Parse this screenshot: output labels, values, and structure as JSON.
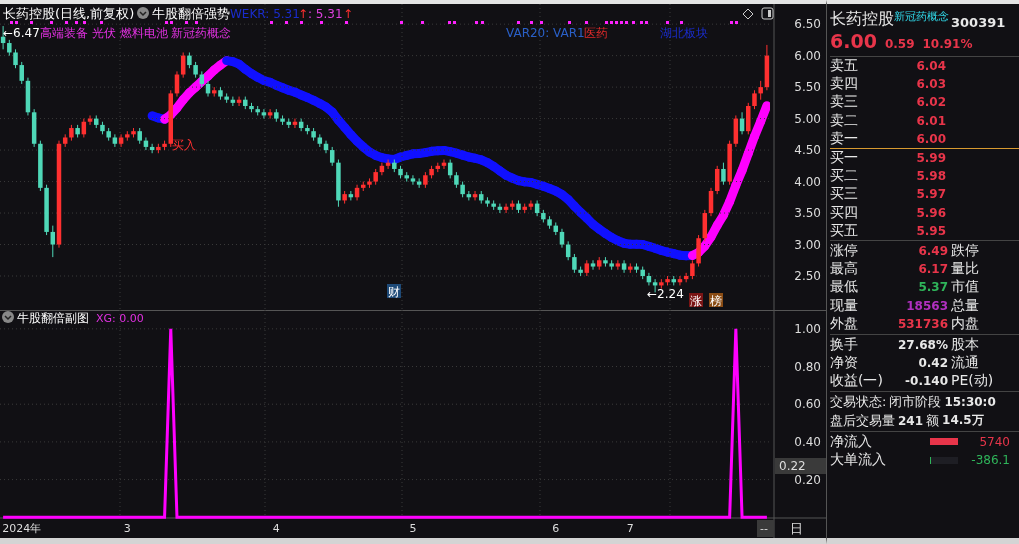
{
  "header": {
    "title": "长药控股(日线,前复权)",
    "indicator": "牛股翻倍强势",
    "wekr": "WEKR: 5.31",
    "arrow": "↑",
    "value2": ": 5.31",
    "arrow2": "↑"
  },
  "main_chart": {
    "high_marker": "←6.47",
    "concepts": "高端装备 光伏 燃料电池 新冠药概念",
    "var_label": "VAR20: VAR1",
    "sector": "医药",
    "region": "湖北板块",
    "buy_label": "买入",
    "low_marker": "←2.24",
    "badges": [
      {
        "text": "财",
        "color": "#1e4a78"
      },
      {
        "text": "涨",
        "color": "#7a1414"
      },
      {
        "text": "榜",
        "color": "#8a4c14"
      }
    ],
    "chart_data": {
      "type": "candlestick",
      "ylim": [
        1.96,
        6.82
      ],
      "grid": true,
      "yticks": [
        {
          "value": 6.5,
          "label": "6.50"
        },
        {
          "value": 6,
          "label": "6.00"
        },
        {
          "value": 5.5,
          "label": "5.50"
        },
        {
          "value": 5,
          "label": "5.00"
        },
        {
          "value": 4.5,
          "label": "4.50"
        },
        {
          "value": 4,
          "label": "4.00"
        },
        {
          "value": 3.5,
          "label": "3.50"
        },
        {
          "value": 3,
          "label": "3.00"
        },
        {
          "value": 2.5,
          "label": "2.50"
        }
      ],
      "categories": [
        null,
        null,
        null,
        null,
        null,
        null,
        null,
        null,
        null,
        null,
        null,
        null,
        null,
        null,
        null,
        null,
        null,
        null,
        null,
        null,
        null,
        null,
        null,
        null,
        null,
        null,
        null,
        null,
        null,
        null,
        null,
        null,
        null,
        null,
        null,
        null,
        null,
        null,
        null,
        null,
        null,
        null,
        null,
        null,
        null,
        null,
        null,
        null,
        null,
        null,
        null,
        null,
        null,
        null,
        null,
        null,
        null,
        null,
        null,
        null,
        null,
        null,
        null,
        null,
        null,
        null,
        null,
        null,
        null,
        null,
        null,
        null,
        null,
        null,
        null,
        null,
        null,
        null,
        null,
        null,
        null,
        null,
        null,
        null,
        null,
        null,
        null,
        null,
        null,
        null,
        null,
        null,
        null,
        null,
        null,
        null,
        null,
        null,
        null,
        null,
        null,
        null,
        null,
        null,
        null,
        null,
        null,
        null,
        null,
        null,
        null,
        null,
        null,
        null,
        null,
        null,
        null,
        null,
        null,
        null,
        null,
        null,
        null,
        null
      ],
      "ohlc": [
        [
          6.3,
          6.47,
          6.1,
          6.2
        ],
        [
          6.2,
          6.25,
          6.0,
          6.05
        ],
        [
          6.05,
          6.1,
          5.8,
          5.85
        ],
        [
          5.85,
          5.9,
          5.55,
          5.6
        ],
        [
          5.6,
          5.65,
          5.05,
          5.1
        ],
        [
          5.1,
          5.15,
          4.55,
          4.6
        ],
        [
          4.6,
          4.65,
          3.85,
          3.9
        ],
        [
          3.9,
          3.95,
          3.15,
          3.2
        ],
        [
          3.2,
          3.3,
          2.8,
          3.0
        ],
        [
          3.0,
          4.65,
          2.95,
          4.6
        ],
        [
          4.6,
          4.75,
          4.55,
          4.7
        ],
        [
          4.7,
          4.9,
          4.65,
          4.85
        ],
        [
          4.85,
          4.9,
          4.7,
          4.75
        ],
        [
          4.75,
          5.0,
          4.7,
          4.95
        ],
        [
          4.95,
          5.05,
          4.9,
          5.0
        ],
        [
          5.0,
          5.05,
          4.85,
          4.9
        ],
        [
          4.9,
          4.95,
          4.75,
          4.8
        ],
        [
          4.8,
          4.85,
          4.65,
          4.7
        ],
        [
          4.7,
          4.75,
          4.55,
          4.6
        ],
        [
          4.6,
          4.75,
          4.55,
          4.7
        ],
        [
          4.7,
          4.8,
          4.65,
          4.75
        ],
        [
          4.75,
          4.85,
          4.7,
          4.8
        ],
        [
          4.8,
          4.85,
          4.6,
          4.65
        ],
        [
          4.65,
          4.7,
          4.5,
          4.55
        ],
        [
          4.55,
          4.6,
          4.45,
          4.5
        ],
        [
          4.5,
          4.6,
          4.45,
          4.55
        ],
        [
          4.55,
          4.65,
          4.5,
          4.6
        ],
        [
          4.6,
          5.45,
          4.55,
          5.4
        ],
        [
          5.4,
          5.75,
          5.35,
          5.7
        ],
        [
          5.7,
          6.05,
          5.65,
          6.0
        ],
        [
          6.0,
          6.05,
          5.8,
          5.85
        ],
        [
          5.85,
          5.9,
          5.65,
          5.7
        ],
        [
          5.7,
          5.75,
          5.5,
          5.55
        ],
        [
          5.55,
          5.6,
          5.35,
          5.4
        ],
        [
          5.4,
          5.5,
          5.35,
          5.45
        ],
        [
          5.45,
          5.5,
          5.3,
          5.35
        ],
        [
          5.35,
          5.4,
          5.25,
          5.3
        ],
        [
          5.3,
          5.35,
          5.2,
          5.25
        ],
        [
          5.25,
          5.35,
          5.2,
          5.3
        ],
        [
          5.3,
          5.35,
          5.15,
          5.2
        ],
        [
          5.2,
          5.25,
          5.1,
          5.15
        ],
        [
          5.15,
          5.2,
          5.05,
          5.1
        ],
        [
          5.1,
          5.15,
          5.0,
          5.05
        ],
        [
          5.05,
          5.15,
          5.0,
          5.1
        ],
        [
          5.1,
          5.15,
          4.95,
          5.0
        ],
        [
          5.0,
          5.05,
          4.9,
          4.95
        ],
        [
          4.95,
          5.0,
          4.85,
          4.9
        ],
        [
          4.9,
          5.0,
          4.85,
          4.95
        ],
        [
          4.95,
          5.0,
          4.8,
          4.85
        ],
        [
          4.85,
          4.9,
          4.75,
          4.8
        ],
        [
          4.8,
          4.85,
          4.65,
          4.7
        ],
        [
          4.7,
          4.75,
          4.55,
          4.6
        ],
        [
          4.6,
          4.65,
          4.45,
          4.5
        ],
        [
          4.5,
          4.55,
          4.25,
          4.3
        ],
        [
          4.3,
          4.35,
          3.6,
          3.7
        ],
        [
          3.7,
          3.85,
          3.65,
          3.8
        ],
        [
          3.8,
          3.85,
          3.7,
          3.75
        ],
        [
          3.75,
          3.95,
          3.7,
          3.9
        ],
        [
          3.9,
          4.0,
          3.85,
          3.95
        ],
        [
          3.95,
          4.05,
          3.9,
          4.0
        ],
        [
          4.0,
          4.2,
          3.95,
          4.15
        ],
        [
          4.15,
          4.3,
          4.1,
          4.25
        ],
        [
          4.25,
          4.35,
          4.2,
          4.3
        ],
        [
          4.3,
          4.35,
          4.15,
          4.2
        ],
        [
          4.2,
          4.25,
          4.05,
          4.1
        ],
        [
          4.1,
          4.15,
          4.0,
          4.05
        ],
        [
          4.05,
          4.1,
          3.95,
          4.0
        ],
        [
          4.0,
          4.05,
          3.9,
          3.95
        ],
        [
          3.95,
          4.15,
          3.9,
          4.1
        ],
        [
          4.1,
          4.25,
          4.05,
          4.2
        ],
        [
          4.2,
          4.3,
          4.15,
          4.25
        ],
        [
          4.25,
          4.35,
          4.2,
          4.3
        ],
        [
          4.3,
          4.35,
          4.05,
          4.1
        ],
        [
          4.1,
          4.15,
          3.9,
          3.95
        ],
        [
          3.95,
          4.0,
          3.75,
          3.8
        ],
        [
          3.8,
          3.85,
          3.7,
          3.75
        ],
        [
          3.75,
          3.85,
          3.7,
          3.8
        ],
        [
          3.8,
          3.85,
          3.65,
          3.7
        ],
        [
          3.7,
          3.75,
          3.6,
          3.65
        ],
        [
          3.65,
          3.7,
          3.55,
          3.6
        ],
        [
          3.6,
          3.65,
          3.5,
          3.55
        ],
        [
          3.55,
          3.65,
          3.5,
          3.6
        ],
        [
          3.6,
          3.7,
          3.55,
          3.65
        ],
        [
          3.65,
          3.7,
          3.5,
          3.55
        ],
        [
          3.55,
          3.65,
          3.5,
          3.6
        ],
        [
          3.6,
          3.7,
          3.55,
          3.65
        ],
        [
          3.65,
          3.7,
          3.45,
          3.5
        ],
        [
          3.5,
          3.55,
          3.35,
          3.4
        ],
        [
          3.4,
          3.45,
          3.25,
          3.3
        ],
        [
          3.3,
          3.35,
          3.15,
          3.2
        ],
        [
          3.2,
          3.25,
          2.95,
          3.0
        ],
        [
          3.0,
          3.05,
          2.75,
          2.8
        ],
        [
          2.8,
          2.85,
          2.55,
          2.6
        ],
        [
          2.6,
          2.65,
          2.5,
          2.55
        ],
        [
          2.55,
          2.75,
          2.5,
          2.7
        ],
        [
          2.7,
          2.75,
          2.6,
          2.65
        ],
        [
          2.65,
          2.8,
          2.6,
          2.75
        ],
        [
          2.75,
          2.8,
          2.65,
          2.7
        ],
        [
          2.7,
          2.75,
          2.6,
          2.65
        ],
        [
          2.65,
          2.75,
          2.6,
          2.7
        ],
        [
          2.7,
          2.75,
          2.55,
          2.6
        ],
        [
          2.6,
          2.7,
          2.55,
          2.65
        ],
        [
          2.65,
          2.7,
          2.55,
          2.6
        ],
        [
          2.6,
          2.65,
          2.45,
          2.5
        ],
        [
          2.5,
          2.55,
          2.35,
          2.4
        ],
        [
          2.4,
          2.45,
          2.24,
          2.35
        ],
        [
          2.35,
          2.45,
          2.3,
          2.4
        ],
        [
          2.4,
          2.5,
          2.35,
          2.45
        ],
        [
          2.45,
          2.5,
          2.35,
          2.4
        ],
        [
          2.4,
          2.5,
          2.35,
          2.45
        ],
        [
          2.45,
          2.55,
          2.4,
          2.5
        ],
        [
          2.5,
          2.75,
          2.45,
          2.7
        ],
        [
          2.7,
          3.15,
          2.65,
          3.1
        ],
        [
          3.1,
          3.55,
          3.05,
          3.5
        ],
        [
          3.5,
          3.9,
          3.45,
          3.85
        ],
        [
          3.85,
          4.25,
          3.8,
          4.2
        ],
        [
          4.2,
          4.3,
          3.95,
          4.0
        ],
        [
          4.0,
          4.65,
          3.95,
          4.6
        ],
        [
          4.6,
          5.05,
          4.55,
          5.0
        ],
        [
          5.0,
          5.1,
          4.75,
          4.8
        ],
        [
          4.8,
          5.25,
          4.75,
          5.2
        ],
        [
          5.2,
          5.45,
          5.15,
          5.4
        ],
        [
          5.4,
          5.6,
          5.3,
          5.5
        ],
        [
          5.5,
          6.17,
          5.45,
          6.0
        ]
      ]
    }
  },
  "sub_chart": {
    "title": "牛股翻倍副图",
    "reading": ": 0.00",
    "current": "0.22",
    "chart_data": {
      "type": "line",
      "ylim": [
        -0.11,
        1.1
      ],
      "grid": true,
      "categories": [
        null,
        null,
        null,
        "2024年",
        null,
        null,
        null,
        null,
        null,
        null,
        null,
        null,
        null,
        null,
        null,
        null,
        null,
        null,
        null,
        null,
        "3",
        null,
        null,
        null,
        null,
        null,
        null,
        null,
        null,
        null,
        null,
        null,
        null,
        null,
        null,
        null,
        null,
        null,
        null,
        null,
        null,
        null,
        null,
        null,
        "4",
        null,
        null,
        null,
        null,
        null,
        null,
        null,
        null,
        null,
        null,
        null,
        null,
        null,
        null,
        null,
        null,
        null,
        null,
        null,
        null,
        null,
        "5",
        null,
        null,
        null,
        null,
        null,
        null,
        null,
        null,
        null,
        null,
        null,
        null,
        null,
        null,
        null,
        null,
        null,
        null,
        null,
        null,
        null,
        null,
        "6",
        null,
        null,
        null,
        null,
        null,
        null,
        null,
        null,
        null,
        null,
        null,
        "7",
        null,
        null,
        null,
        null,
        null,
        null,
        null,
        null,
        null,
        null,
        null,
        null,
        null,
        null,
        null,
        null,
        null,
        null,
        null,
        null,
        null,
        null
      ],
      "series": [
        {
          "name": "XG",
          "color": "#ff00ff",
          "values": [
            0,
            0,
            0,
            0,
            0,
            0,
            0,
            0,
            0,
            0,
            0,
            0,
            0,
            0,
            0,
            0,
            0,
            0,
            0,
            0,
            0,
            0,
            0,
            0,
            0,
            0,
            0,
            1,
            0,
            0,
            0,
            0,
            0,
            0,
            0,
            0,
            0,
            0,
            0,
            0,
            0,
            0,
            0,
            0,
            0,
            0,
            0,
            0,
            0,
            0,
            0,
            0,
            0,
            0,
            0,
            0,
            0,
            0,
            0,
            0,
            0,
            0,
            0,
            0,
            0,
            0,
            0,
            0,
            0,
            0,
            0,
            0,
            0,
            0,
            0,
            0,
            0,
            0,
            0,
            0,
            0,
            0,
            0,
            0,
            0,
            0,
            0,
            0,
            0,
            0,
            0,
            0,
            0,
            0,
            0,
            0,
            0,
            0,
            0,
            0,
            0,
            0,
            0,
            0,
            0,
            0,
            0,
            0,
            0,
            0,
            0,
            0,
            0,
            0,
            0,
            0,
            0,
            0,
            1,
            0,
            0,
            0,
            0,
            0
          ]
        }
      ],
      "yticks": [
        {
          "value": 1,
          "label": "1.00"
        },
        {
          "value": 0.8,
          "label": "0.80"
        },
        {
          "value": 0.6,
          "label": "0.60"
        },
        {
          "value": 0.4,
          "label": "0.40"
        },
        {
          "value": 0.2,
          "label": "0.20"
        }
      ]
    }
  },
  "x_axis": {
    "end": "--",
    "period": "日"
  },
  "quote": {
    "name": "长药控股",
    "concept": "新冠药概念",
    "code": "300391",
    "price": "6.00",
    "change": "0.59",
    "change_pct": "10.91%",
    "order_book": [
      {
        "label": "卖五",
        "price": "6.04"
      },
      {
        "label": "卖四",
        "price": "6.03"
      },
      {
        "label": "卖三",
        "price": "6.02"
      },
      {
        "label": "卖二",
        "price": "6.01"
      },
      {
        "label": "卖一",
        "price": "6.00"
      },
      {
        "label": "买一",
        "price": "5.99"
      },
      {
        "label": "买二",
        "price": "5.98"
      },
      {
        "label": "买三",
        "price": "5.97"
      },
      {
        "label": "买四",
        "price": "5.96"
      },
      {
        "label": "买五",
        "price": "5.95"
      }
    ],
    "stats": [
      {
        "label": "涨停",
        "value": "6.49",
        "color": "#e8354a",
        "label2": "跌停"
      },
      {
        "label": "最高",
        "value": "6.17",
        "color": "#e8354a",
        "label2": "量比"
      },
      {
        "label": "最低",
        "value": "5.37",
        "color": "#2fb45a",
        "label2": "市值"
      },
      {
        "label": "现量",
        "value": "18563",
        "color": "#b030c0",
        "label2": "总量"
      },
      {
        "label": "外盘",
        "value": "531736",
        "color": "#e8354a",
        "label2": "内盘"
      }
    ],
    "fundamentals": [
      {
        "label": "换手",
        "value": "27.68%",
        "label2": "股本"
      },
      {
        "label": "净资",
        "value": "0.42",
        "label2": "流通"
      },
      {
        "label": "收益(一)",
        "value": "-0.140",
        "label2": "PE(动)"
      }
    ],
    "trade_status": {
      "label": "交易状态:",
      "state": "闭市阶段",
      "time": "15:30:0"
    },
    "after_hours": {
      "label": "盘后交易量",
      "volume": "241",
      "amount_label": "额",
      "amount": "14.5万"
    },
    "flows": [
      {
        "label": "净流入",
        "value": "5740",
        "color": "#e8354a",
        "level": 1
      },
      {
        "label": "大单流入",
        "value": "-386.1",
        "color": "#2fb45a",
        "level": 0.04
      }
    ]
  }
}
